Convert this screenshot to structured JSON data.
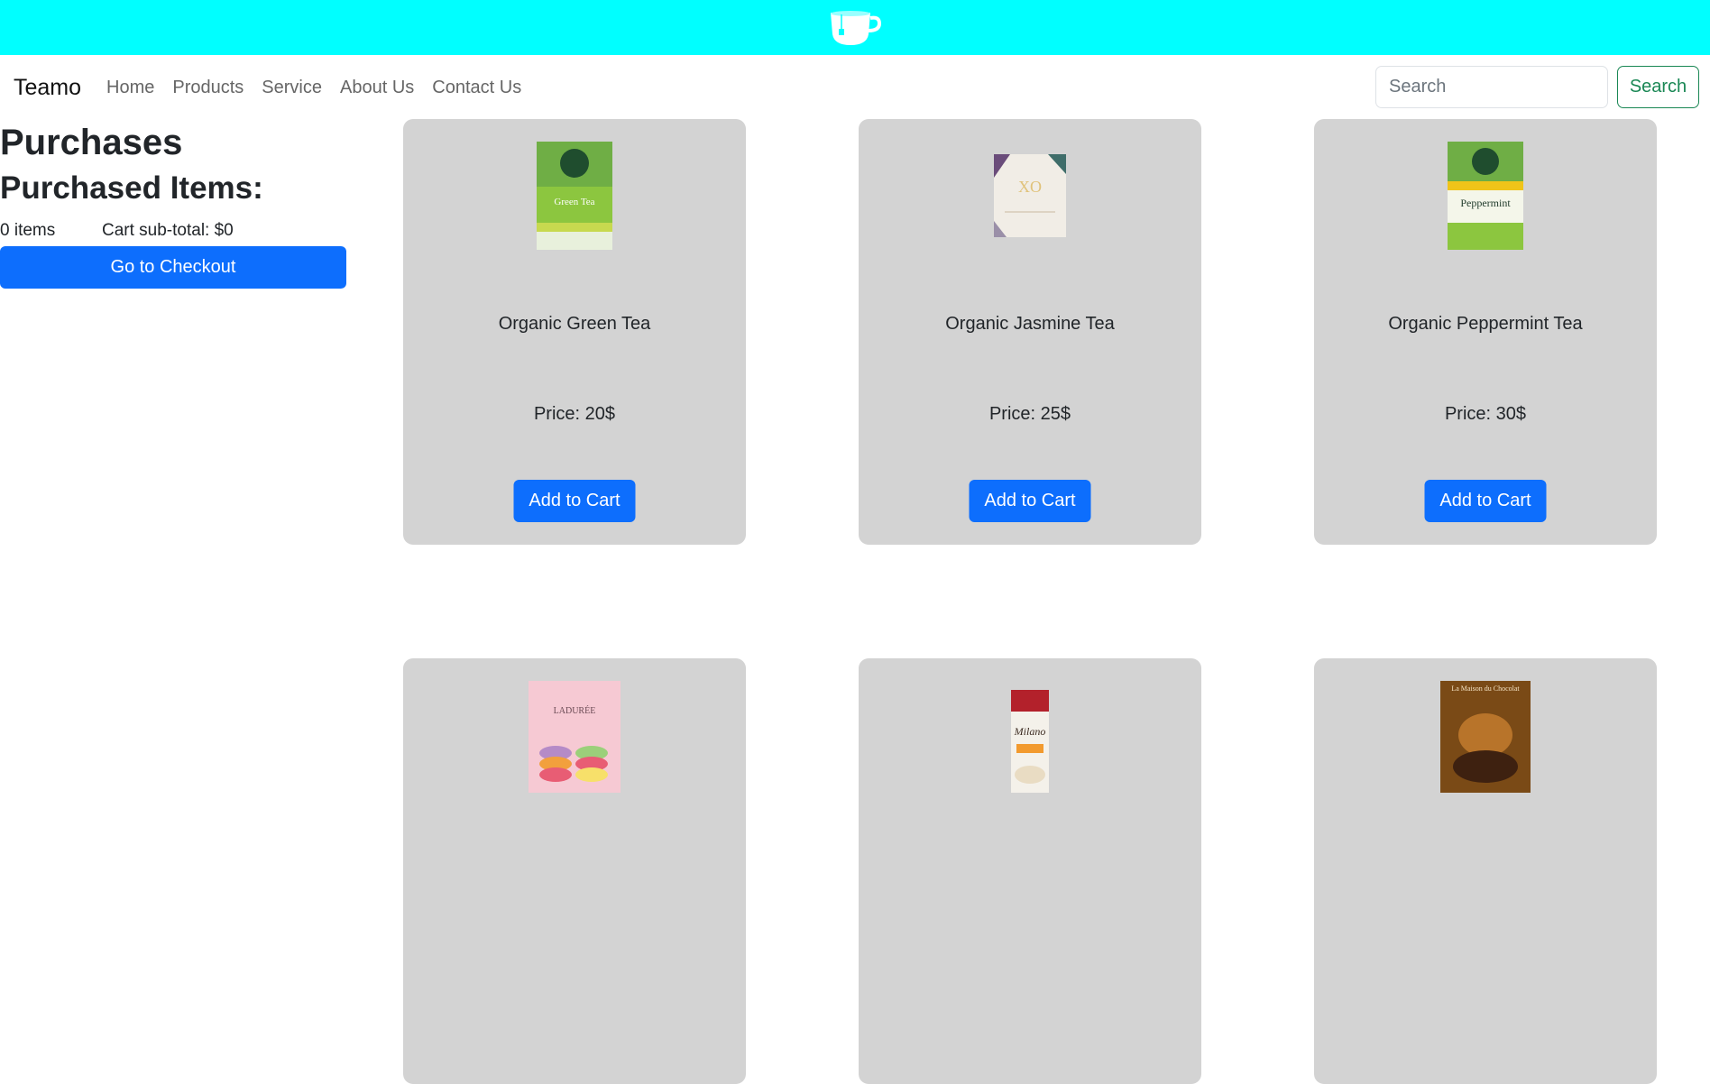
{
  "header": {
    "logo_icon": "tea-cup-icon",
    "bg_color": "#00ffff"
  },
  "navbar": {
    "brand": "Teamo",
    "links": [
      "Home",
      "Products",
      "Service",
      "About Us",
      "Contact Us"
    ],
    "search_placeholder": "Search",
    "search_button": "Search"
  },
  "purchases": {
    "title": "Purchases",
    "subtitle": "Purchased Items:",
    "item_count": "0 items",
    "subtotal": "Cart sub-total: $0",
    "checkout_label": "Go to Checkout"
  },
  "products": [
    {
      "name": "Organic Green Tea",
      "price": "Price: 20$",
      "button": "Add to Cart",
      "image_text": "Green Tea"
    },
    {
      "name": "Organic Jasmine Tea",
      "price": "Price: 25$",
      "button": "Add to Cart",
      "image_text": "XO"
    },
    {
      "name": "Organic Peppermint Tea",
      "price": "Price: 30$",
      "button": "Add to Cart",
      "image_text": "Peppermint"
    },
    {
      "name": "",
      "price": "",
      "button": "",
      "image_text": "LADURÉE"
    },
    {
      "name": "",
      "price": "",
      "button": "",
      "image_text": "Milano"
    },
    {
      "name": "",
      "price": "",
      "button": "",
      "image_text": "La Maison du Chocolat"
    }
  ],
  "colors": {
    "primary": "#0d6efd",
    "card_bg": "#d3d3d3",
    "success": "#198754"
  }
}
